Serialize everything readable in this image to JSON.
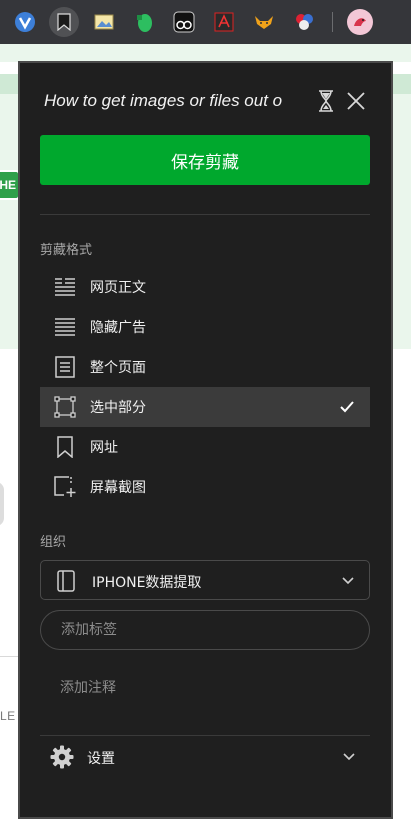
{
  "toolbar": {
    "extensions": [
      {
        "name": "v-extension-icon"
      },
      {
        "name": "evernote-clipper-icon",
        "active": true
      },
      {
        "name": "image-extension-icon"
      },
      {
        "name": "evernote-icon"
      },
      {
        "name": "tampermonkey-icon"
      },
      {
        "name": "pdf-icon"
      },
      {
        "name": "fox-icon"
      },
      {
        "name": "balls-icon"
      },
      {
        "name": "avatar-icon"
      }
    ]
  },
  "page": {
    "pill_text": "HE",
    "partial_text": "LE"
  },
  "clipper": {
    "title": "How to get images or files out o",
    "save_label": "保存剪藏",
    "format_section_label": "剪藏格式",
    "formats": [
      {
        "label": "网页正文",
        "icon": "article-icon",
        "selected": false
      },
      {
        "label": "隐藏广告",
        "icon": "simplified-article-icon",
        "selected": false
      },
      {
        "label": "整个页面",
        "icon": "full-page-icon",
        "selected": false
      },
      {
        "label": "选中部分",
        "icon": "selection-icon",
        "selected": true
      },
      {
        "label": "网址",
        "icon": "bookmark-icon",
        "selected": false
      },
      {
        "label": "屏幕截图",
        "icon": "screenshot-icon",
        "selected": false
      }
    ],
    "organize_section_label": "组织",
    "notebook": "IPHONE数据提取",
    "tag_placeholder": "添加标签",
    "note_placeholder": "添加注释",
    "settings_label": "设置"
  },
  "colors": {
    "accent": "#00a82d",
    "panel_bg": "#1f1f1f",
    "toolbar_bg": "#35363a"
  }
}
